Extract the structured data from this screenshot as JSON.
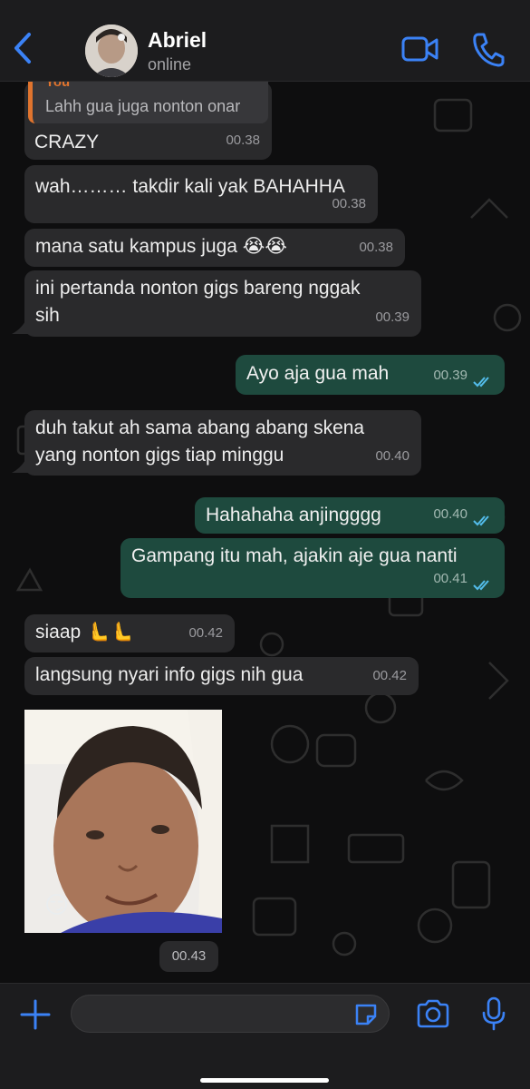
{
  "header": {
    "back_icon": "chevron-left-icon",
    "contact_name": "Abriel",
    "status": "online",
    "video_icon": "video-call-icon",
    "call_icon": "phone-icon",
    "accent": "#3b82f6"
  },
  "messages": [
    {
      "dir": "in",
      "text": "CRAZY",
      "time": "00.38",
      "quote_author": "You",
      "quote_text": "Lahh gua juga nonton onar"
    },
    {
      "dir": "in",
      "text": "wah……… takdir kali yak BAHAHHA",
      "time": "00.38"
    },
    {
      "dir": "in",
      "text": "mana satu kampus juga 😭😭",
      "time": "00.38"
    },
    {
      "dir": "in",
      "line1": "ini pertanda nonton gigs bareng nggak",
      "line2": "sih",
      "time": "00.39"
    },
    {
      "dir": "out",
      "text": "Ayo aja gua mah",
      "time": "00.39"
    },
    {
      "dir": "in",
      "line1": "duh takut ah sama abang abang skena",
      "line2": "yang nonton gigs tiap minggu",
      "time": "00.40"
    },
    {
      "dir": "out",
      "text": "Hahahaha anjingggg",
      "time": "00.40"
    },
    {
      "dir": "out",
      "text": "Gampang itu mah, ajakin aje gua nanti",
      "time": "00.41"
    },
    {
      "dir": "in",
      "text": "siaap 🫷🫷",
      "time": "00.42"
    },
    {
      "dir": "in",
      "text": "langsung nyari info gigs nih gua",
      "time": "00.42"
    },
    {
      "dir": "in",
      "type": "image",
      "overlay_emoji": "😏",
      "time": "00.43"
    }
  ],
  "composer": {
    "add_icon": "plus-icon",
    "placeholder": "",
    "sticker_icon": "sticker-icon",
    "camera_icon": "camera-icon",
    "mic_icon": "microphone-icon"
  },
  "colors": {
    "incoming_bubble": "#2a2a2c",
    "outgoing_bubble": "#1e4a3e",
    "read_ticks": "#53bdeb"
  }
}
